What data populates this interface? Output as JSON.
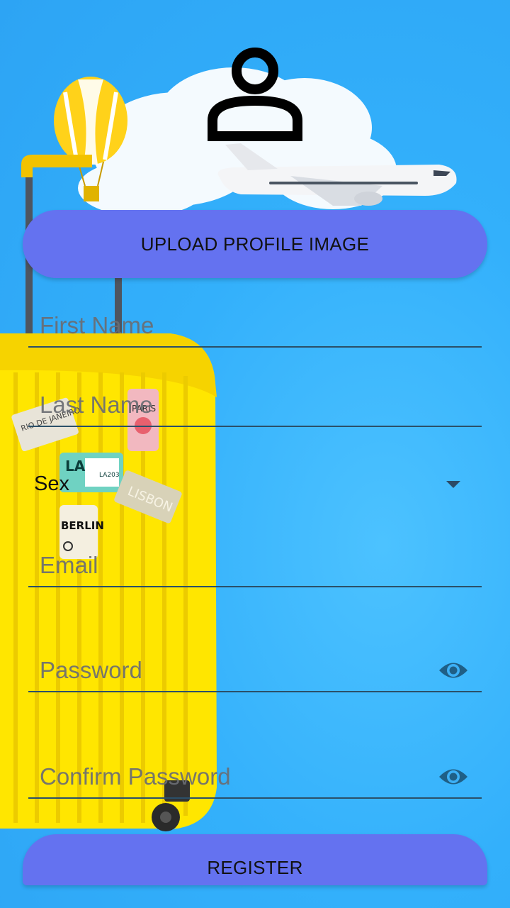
{
  "upload": {
    "label": "UPLOAD PROFILE IMAGE"
  },
  "form": {
    "first_name_placeholder": "First Name",
    "last_name_placeholder": "Last Name",
    "sex_label": "Sex",
    "email_placeholder": "Email",
    "password_placeholder": "Password",
    "confirm_password_placeholder": "Confirm Password"
  },
  "register": {
    "label": "REGISTER"
  },
  "background": {
    "sticker_labels": [
      "RIO DE JANEIRO",
      "PARIS",
      "LA",
      "LA203",
      "LISBON",
      "BERLIN"
    ]
  },
  "icons": {
    "profile": "person-outline-icon",
    "password_toggle": "eye-icon",
    "sex_dropdown": "caret-down-icon"
  },
  "colors": {
    "button": "#6472f0",
    "accent_dark": "#2b5069",
    "suitcase": "#ffe600"
  }
}
